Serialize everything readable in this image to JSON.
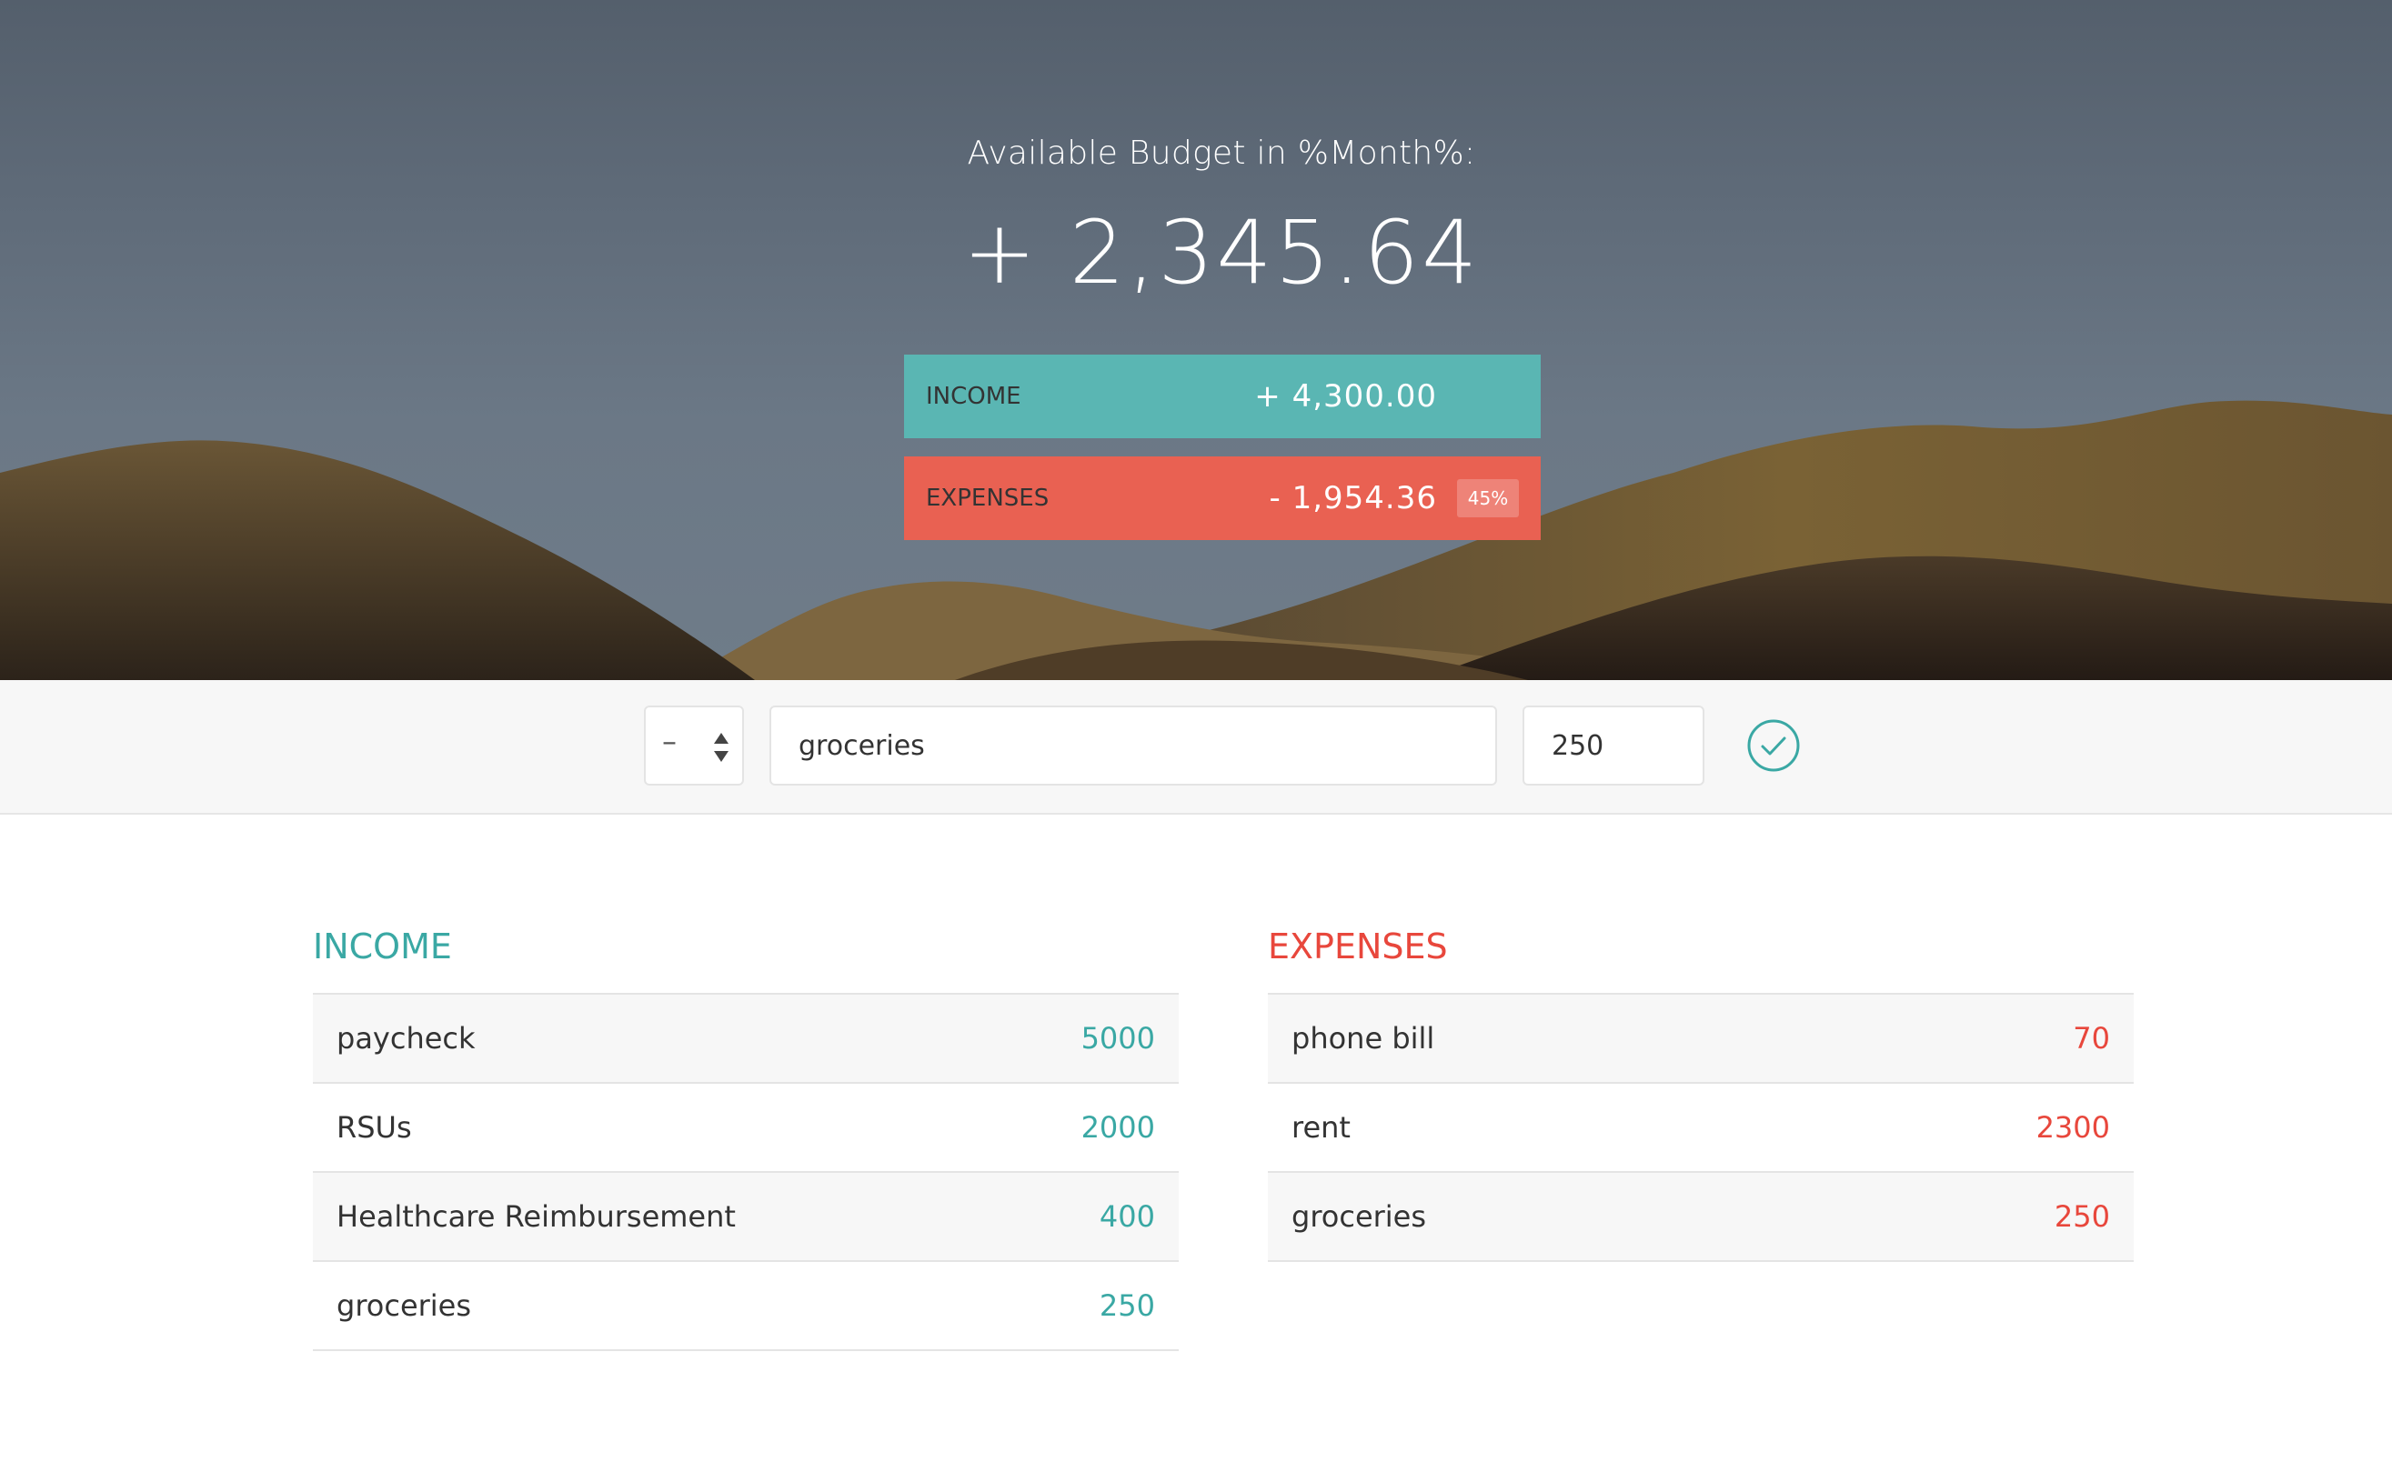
{
  "header": {
    "title": "Available Budget in %Month%:",
    "budget": "+ 2,345.64",
    "income": {
      "label": "INCOME",
      "value": "+ 4,300.00"
    },
    "expenses": {
      "label": "EXPENSES",
      "value": "- 1,954.36",
      "percentage": "45%"
    }
  },
  "add_form": {
    "type_value": "–",
    "description_value": "groceries",
    "value_value": "250",
    "submit_icon": "check-circle-icon"
  },
  "income_list": {
    "title": "INCOME",
    "items": [
      {
        "description": "paycheck",
        "value": "5000"
      },
      {
        "description": "RSUs",
        "value": "2000"
      },
      {
        "description": "Healthcare Reimbursement",
        "value": "400"
      },
      {
        "description": "groceries",
        "value": "250"
      }
    ]
  },
  "expenses_list": {
    "title": "EXPENSES",
    "items": [
      {
        "description": "phone bill",
        "value": "70"
      },
      {
        "description": "rent",
        "value": "2300"
      },
      {
        "description": "groceries",
        "value": "250"
      }
    ]
  },
  "colors": {
    "income": "#5ab6b3",
    "income_text": "#3aa8a4",
    "expenses": "#e96152",
    "expenses_text": "#e8473c"
  }
}
